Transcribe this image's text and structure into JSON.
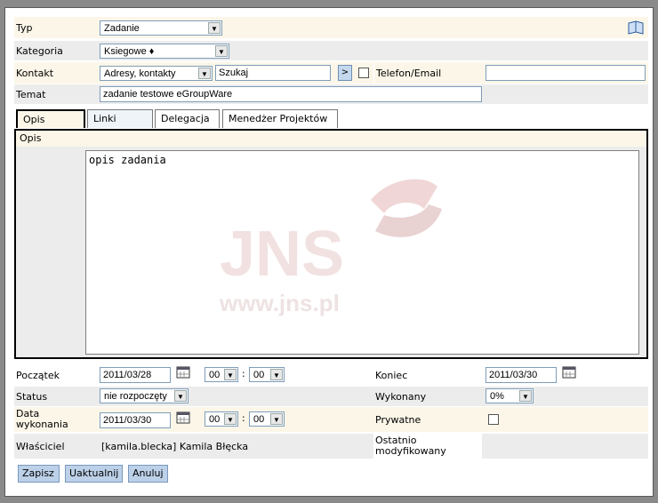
{
  "form": {
    "typ": {
      "label": "Typ",
      "value": "Zadanie"
    },
    "kategoria": {
      "label": "Kategoria",
      "value": "Ksiegowe ♦"
    },
    "kontakt": {
      "label": "Kontakt",
      "select_value": "Adresy, kontakty",
      "search_value": "Szukaj",
      "go_label": ">",
      "phone_label": "Telefon/Email",
      "phone_value": ""
    },
    "temat": {
      "label": "Temat",
      "value": "zadanie testowe eGroupWare"
    }
  },
  "tabs": [
    {
      "label": "Opis",
      "active": true
    },
    {
      "label": "Linki",
      "active": false
    },
    {
      "label": "Delegacja",
      "active": false
    },
    {
      "label": "Menedżer Projektów",
      "active": false
    }
  ],
  "opis": {
    "section_label": "Opis",
    "text": "opis zadania"
  },
  "watermark": {
    "brand": "JNS",
    "url": "www.jns.pl"
  },
  "dates": {
    "start": {
      "label": "Początek",
      "date": "2011/03/28",
      "hour": "00",
      "minute": "00",
      "sep": ":"
    },
    "end": {
      "label": "Koniec",
      "date": "2011/03/30"
    },
    "status": {
      "label": "Status",
      "value": "nie rozpoczęty"
    },
    "done": {
      "label": "Wykonany",
      "value": "0%"
    },
    "completion": {
      "label": "Data wykonania",
      "date": "2011/03/30",
      "hour": "00",
      "minute": "00",
      "sep": ":"
    },
    "private": {
      "label": "Prywatne"
    },
    "owner": {
      "label": "Właściciel",
      "value": "[kamila.blecka] Kamila Błęcka"
    },
    "modified": {
      "label": "Ostatnio modyfikowany",
      "value": ""
    }
  },
  "buttons": {
    "save": "Zapisz",
    "update": "Uaktualnij",
    "cancel": "Anuluj"
  },
  "colors": {
    "row_odd": "#fbf6e8",
    "row_even": "#ececec",
    "button": "#bcd0e8",
    "watermark": "#e8c8c8"
  }
}
